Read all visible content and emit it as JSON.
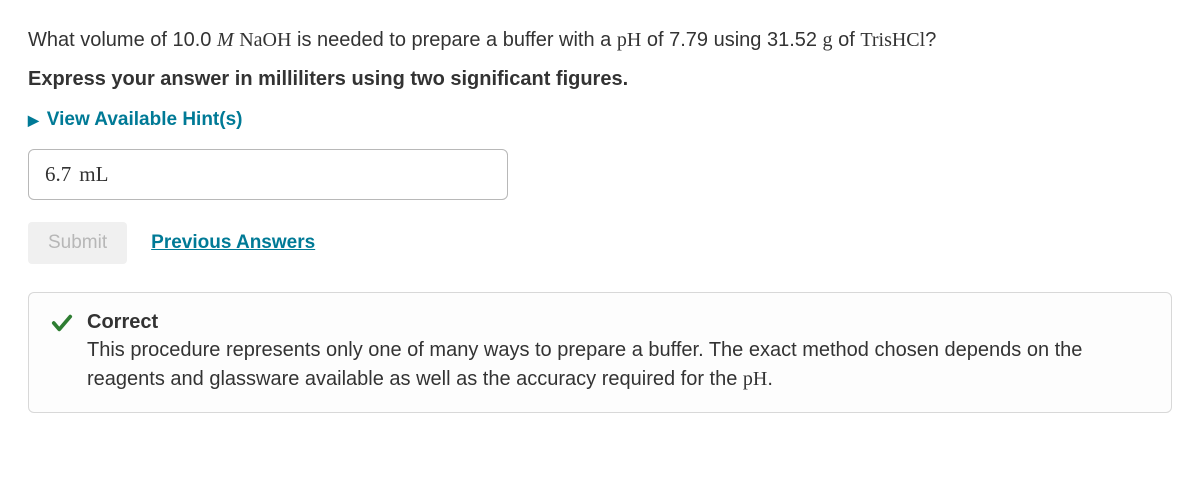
{
  "question": {
    "pre1": "What volume of 10.0 ",
    "M": "M",
    "sp1": " ",
    "compound1": "NaOH",
    "mid1": " is needed to prepare a buffer with a ",
    "pH": "pH",
    "mid2": " of 7.79 using 31.52 ",
    "g": "g",
    "mid3": " of ",
    "compound2": "TrisHCl",
    "end": "?"
  },
  "instruction": "Express your answer in milliliters using two significant figures.",
  "hints_label": "View Available Hint(s)",
  "answer": {
    "value": "6.7",
    "unit": "mL"
  },
  "buttons": {
    "submit": "Submit",
    "previous": "Previous Answers"
  },
  "feedback": {
    "title": "Correct",
    "body_pre": "This procedure represents only one of many ways to prepare a buffer.  The exact method chosen depends on the reagents and glassware available as well as the accuracy required for the ",
    "body_ph": "pH",
    "body_post": "."
  }
}
